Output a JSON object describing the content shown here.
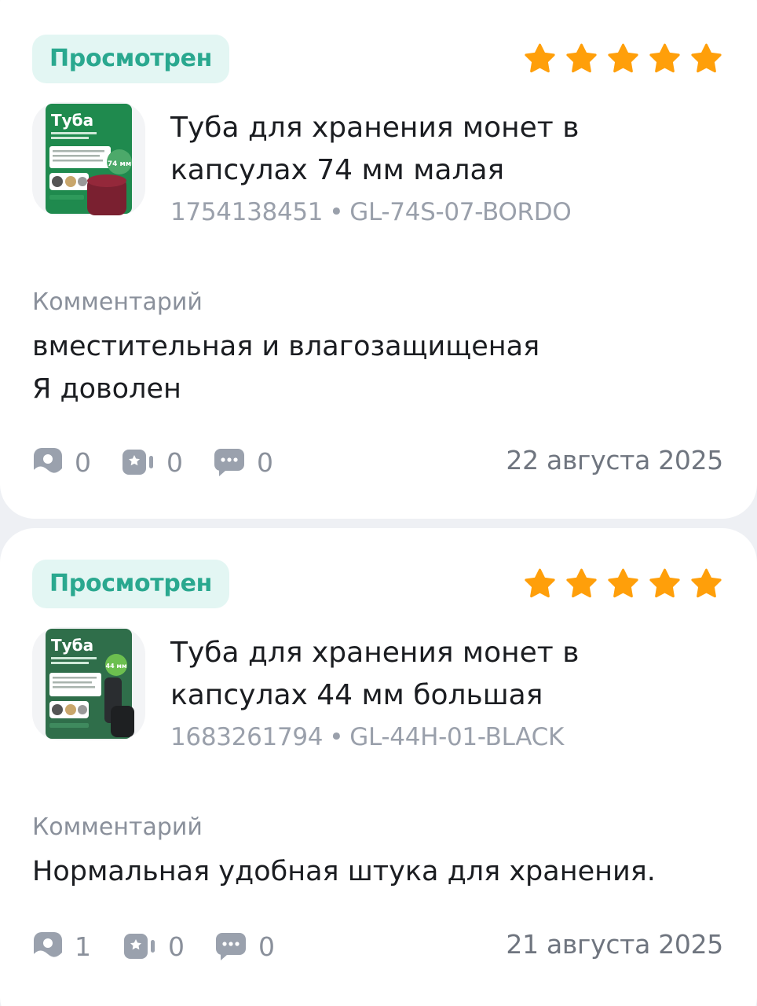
{
  "colors": {
    "badge_bg": "#e3f6f3",
    "badge_text": "#2aa88f",
    "star": "#ff9f0a",
    "muted": "#8a909b",
    "card_bg": "#ffffff",
    "page_bg": "#eef0f4"
  },
  "reviews": [
    {
      "status": "Просмотрен",
      "rating": 5,
      "product": {
        "title": "Туба для хранения монет в капсулах 74 мм малая",
        "id": "1754138451",
        "separator": "•",
        "sku": "GL-74S-07-BORDO",
        "image_label": "Туба",
        "image_size_label": "74 мм"
      },
      "comment_label": "Комментарий",
      "comment": "вместительная и влагозащищеная\nЯ доволен",
      "stats": {
        "photos": "0",
        "videos": "0",
        "comments": "0"
      },
      "date": "22 августа 2025"
    },
    {
      "status": "Просмотрен",
      "rating": 5,
      "product": {
        "title": "Туба для хранения монет в капсулах 44 мм большая",
        "id": "1683261794",
        "separator": "•",
        "sku": "GL-44H-01-BLACK",
        "image_label": "Туба",
        "image_size_label": "44 мм"
      },
      "comment_label": "Комментарий",
      "comment": "Нормальная удобная штука для хранения.",
      "stats": {
        "photos": "1",
        "videos": "0",
        "comments": "0"
      },
      "date": "21 августа 2025"
    }
  ]
}
